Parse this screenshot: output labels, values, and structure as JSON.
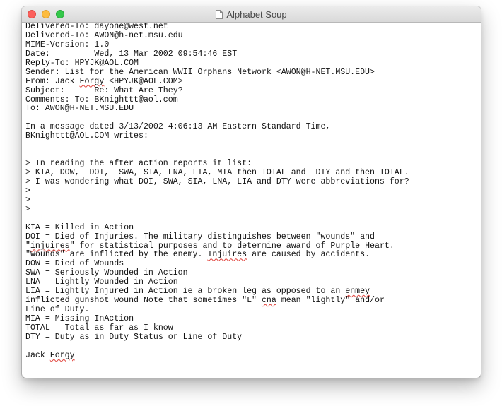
{
  "window": {
    "title": "Alphabet Soup"
  },
  "email": {
    "lines": [
      "Delivered-To: dayone@west.net",
      "Delivered-To: AWON@h-net.msu.edu",
      "MIME-Version: 1.0",
      "Date:         Wed, 13 Mar 2002 09:54:46 EST",
      "Reply-To: HPYJK@AOL.COM",
      "Sender: List for the American WWII Orphans Network <AWON@H-NET.MSU.EDU>",
      "From: Jack Forgy <HPYJK@AOL.COM>",
      "Subject:      Re: What Are They?",
      "Comments: To: BKnighttt@aol.com",
      "To: AWON@H-NET.MSU.EDU",
      "",
      "In a message dated 3/13/2002 4:06:13 AM Eastern Standard Time,",
      "BKnighttt@AOL.COM writes:",
      "",
      "",
      "> In reading the after action reports it list:",
      "> KIA, DOW,  DOI,  SWA, SIA, LNA, LIA, MIA then TOTAL and  DTY and then TOTAL.",
      "> I was wondering what DOI, SWA, SIA, LNA, LIA and DTY were abbreviations for?",
      ">",
      ">",
      ">",
      "",
      "KIA = Killed in Action",
      "DOI = Died of Injuries. The military distinguishes between \"wounds\" and",
      "\"injuires\" for statistical purposes and to determine award of Purple Heart.",
      "\"Wounds\" are inflicted by the enemy. Injuires are caused by accidents.",
      "DOW = Died of Wounds",
      "SWA = Seriously Wounded in Action",
      "LNA = Lightly Wounded in Action",
      "LIA = Lightly Injured in Action ie a broken leg as opposed to an enmey",
      "inflicted gunshot wound Note that sometimes \"L\" cna mean \"lightly\" and/or",
      "Line of Duty.",
      "MIA = Missing InAction",
      "TOTAL = Total as far as I know",
      "DTY = Duty as in Duty Status or Line of Duty",
      "",
      "Jack Forgy"
    ],
    "misspelled_words": [
      "Forgy",
      "injuires",
      "Injuires",
      "enmey",
      "cna"
    ]
  },
  "colors": {
    "close": "#fc605c",
    "minimize": "#fdbc40",
    "zoom": "#34c84a",
    "spellcheck_underline": "#e0413a"
  },
  "icons": {
    "title_icon": "document-icon"
  }
}
